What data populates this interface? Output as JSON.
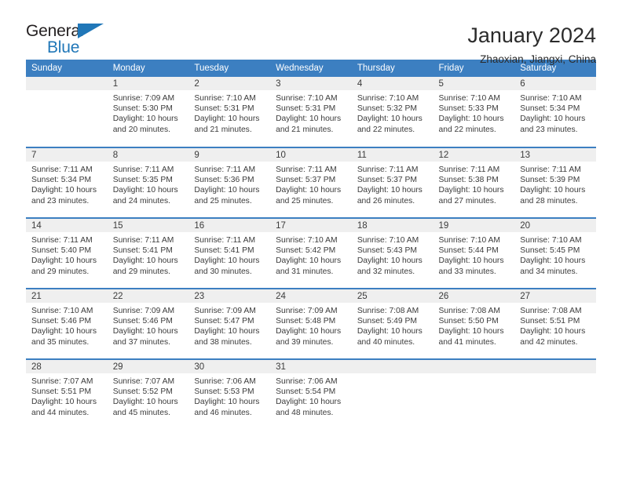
{
  "brand": {
    "name_top": "General",
    "name_bottom": "Blue",
    "accent_color": "#2077b8",
    "text_color": "#231f20"
  },
  "header": {
    "title": "January 2024",
    "subtitle": "Zhaoxian, Jiangxi, China"
  },
  "theme": {
    "header_row_background": "#3c7fc1",
    "header_row_text": "#ffffff",
    "daynum_band_background": "#efefef",
    "cell_background": "#ffffff",
    "cell_text": "#3b3b3b",
    "row_divider": "#3c7fc1"
  },
  "weekday_headers": [
    "Sunday",
    "Monday",
    "Tuesday",
    "Wednesday",
    "Thursday",
    "Friday",
    "Saturday"
  ],
  "weeks": [
    [
      {
        "day": "",
        "lines": []
      },
      {
        "day": "1",
        "lines": [
          "Sunrise: 7:09 AM",
          "Sunset: 5:30 PM",
          "Daylight: 10 hours",
          "and 20 minutes."
        ]
      },
      {
        "day": "2",
        "lines": [
          "Sunrise: 7:10 AM",
          "Sunset: 5:31 PM",
          "Daylight: 10 hours",
          "and 21 minutes."
        ]
      },
      {
        "day": "3",
        "lines": [
          "Sunrise: 7:10 AM",
          "Sunset: 5:31 PM",
          "Daylight: 10 hours",
          "and 21 minutes."
        ]
      },
      {
        "day": "4",
        "lines": [
          "Sunrise: 7:10 AM",
          "Sunset: 5:32 PM",
          "Daylight: 10 hours",
          "and 22 minutes."
        ]
      },
      {
        "day": "5",
        "lines": [
          "Sunrise: 7:10 AM",
          "Sunset: 5:33 PM",
          "Daylight: 10 hours",
          "and 22 minutes."
        ]
      },
      {
        "day": "6",
        "lines": [
          "Sunrise: 7:10 AM",
          "Sunset: 5:34 PM",
          "Daylight: 10 hours",
          "and 23 minutes."
        ]
      }
    ],
    [
      {
        "day": "7",
        "lines": [
          "Sunrise: 7:11 AM",
          "Sunset: 5:34 PM",
          "Daylight: 10 hours",
          "and 23 minutes."
        ]
      },
      {
        "day": "8",
        "lines": [
          "Sunrise: 7:11 AM",
          "Sunset: 5:35 PM",
          "Daylight: 10 hours",
          "and 24 minutes."
        ]
      },
      {
        "day": "9",
        "lines": [
          "Sunrise: 7:11 AM",
          "Sunset: 5:36 PM",
          "Daylight: 10 hours",
          "and 25 minutes."
        ]
      },
      {
        "day": "10",
        "lines": [
          "Sunrise: 7:11 AM",
          "Sunset: 5:37 PM",
          "Daylight: 10 hours",
          "and 25 minutes."
        ]
      },
      {
        "day": "11",
        "lines": [
          "Sunrise: 7:11 AM",
          "Sunset: 5:37 PM",
          "Daylight: 10 hours",
          "and 26 minutes."
        ]
      },
      {
        "day": "12",
        "lines": [
          "Sunrise: 7:11 AM",
          "Sunset: 5:38 PM",
          "Daylight: 10 hours",
          "and 27 minutes."
        ]
      },
      {
        "day": "13",
        "lines": [
          "Sunrise: 7:11 AM",
          "Sunset: 5:39 PM",
          "Daylight: 10 hours",
          "and 28 minutes."
        ]
      }
    ],
    [
      {
        "day": "14",
        "lines": [
          "Sunrise: 7:11 AM",
          "Sunset: 5:40 PM",
          "Daylight: 10 hours",
          "and 29 minutes."
        ]
      },
      {
        "day": "15",
        "lines": [
          "Sunrise: 7:11 AM",
          "Sunset: 5:41 PM",
          "Daylight: 10 hours",
          "and 29 minutes."
        ]
      },
      {
        "day": "16",
        "lines": [
          "Sunrise: 7:11 AM",
          "Sunset: 5:41 PM",
          "Daylight: 10 hours",
          "and 30 minutes."
        ]
      },
      {
        "day": "17",
        "lines": [
          "Sunrise: 7:10 AM",
          "Sunset: 5:42 PM",
          "Daylight: 10 hours",
          "and 31 minutes."
        ]
      },
      {
        "day": "18",
        "lines": [
          "Sunrise: 7:10 AM",
          "Sunset: 5:43 PM",
          "Daylight: 10 hours",
          "and 32 minutes."
        ]
      },
      {
        "day": "19",
        "lines": [
          "Sunrise: 7:10 AM",
          "Sunset: 5:44 PM",
          "Daylight: 10 hours",
          "and 33 minutes."
        ]
      },
      {
        "day": "20",
        "lines": [
          "Sunrise: 7:10 AM",
          "Sunset: 5:45 PM",
          "Daylight: 10 hours",
          "and 34 minutes."
        ]
      }
    ],
    [
      {
        "day": "21",
        "lines": [
          "Sunrise: 7:10 AM",
          "Sunset: 5:46 PM",
          "Daylight: 10 hours",
          "and 35 minutes."
        ]
      },
      {
        "day": "22",
        "lines": [
          "Sunrise: 7:09 AM",
          "Sunset: 5:46 PM",
          "Daylight: 10 hours",
          "and 37 minutes."
        ]
      },
      {
        "day": "23",
        "lines": [
          "Sunrise: 7:09 AM",
          "Sunset: 5:47 PM",
          "Daylight: 10 hours",
          "and 38 minutes."
        ]
      },
      {
        "day": "24",
        "lines": [
          "Sunrise: 7:09 AM",
          "Sunset: 5:48 PM",
          "Daylight: 10 hours",
          "and 39 minutes."
        ]
      },
      {
        "day": "25",
        "lines": [
          "Sunrise: 7:08 AM",
          "Sunset: 5:49 PM",
          "Daylight: 10 hours",
          "and 40 minutes."
        ]
      },
      {
        "day": "26",
        "lines": [
          "Sunrise: 7:08 AM",
          "Sunset: 5:50 PM",
          "Daylight: 10 hours",
          "and 41 minutes."
        ]
      },
      {
        "day": "27",
        "lines": [
          "Sunrise: 7:08 AM",
          "Sunset: 5:51 PM",
          "Daylight: 10 hours",
          "and 42 minutes."
        ]
      }
    ],
    [
      {
        "day": "28",
        "lines": [
          "Sunrise: 7:07 AM",
          "Sunset: 5:51 PM",
          "Daylight: 10 hours",
          "and 44 minutes."
        ]
      },
      {
        "day": "29",
        "lines": [
          "Sunrise: 7:07 AM",
          "Sunset: 5:52 PM",
          "Daylight: 10 hours",
          "and 45 minutes."
        ]
      },
      {
        "day": "30",
        "lines": [
          "Sunrise: 7:06 AM",
          "Sunset: 5:53 PM",
          "Daylight: 10 hours",
          "and 46 minutes."
        ]
      },
      {
        "day": "31",
        "lines": [
          "Sunrise: 7:06 AM",
          "Sunset: 5:54 PM",
          "Daylight: 10 hours",
          "and 48 minutes."
        ]
      },
      {
        "day": "",
        "lines": []
      },
      {
        "day": "",
        "lines": []
      },
      {
        "day": "",
        "lines": []
      }
    ]
  ]
}
